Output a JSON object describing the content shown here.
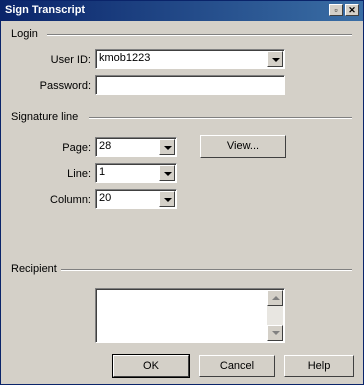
{
  "window": {
    "title": "Sign Transcript"
  },
  "groups": {
    "login": "Login",
    "signature_line": "Signature line",
    "recipient": "Recipient"
  },
  "login": {
    "user_id_label": "User ID:",
    "user_id_value": "kmob1223",
    "password_label": "Password:",
    "password_value": ""
  },
  "signature": {
    "page_label": "Page:",
    "page_value": "28",
    "line_label": "Line:",
    "line_value": "1",
    "column_label": "Column:",
    "column_value": "20",
    "view_button": "View..."
  },
  "recipient": {
    "text": ""
  },
  "buttons": {
    "ok": "OK",
    "cancel": "Cancel",
    "help": "Help"
  },
  "colors": {
    "titlebar_start": "#0a246a",
    "titlebar_end": "#3a6ea5",
    "face": "#d4d0c8"
  }
}
